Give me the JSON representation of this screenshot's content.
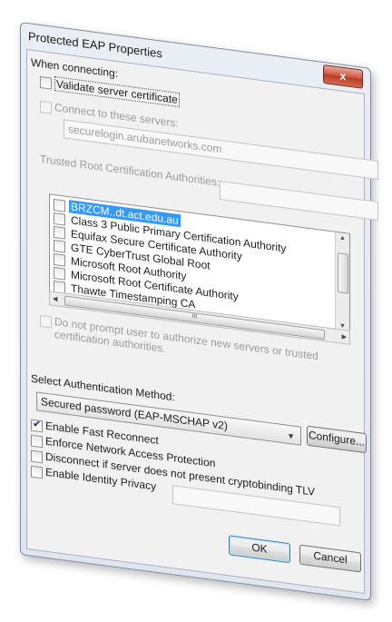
{
  "window": {
    "title": "Protected EAP Properties",
    "close_label": "x"
  },
  "when_connecting_label": "When connecting:",
  "validate_cert": {
    "label": "Validate server certificate",
    "checked": false
  },
  "connect_servers": {
    "label": "Connect to these servers:",
    "checked": false,
    "value": "securelogin.arubanetworks.com"
  },
  "trusted_ca_label": "Trusted Root Certification Authorities:",
  "ca_list": [
    {
      "label": "BRZCM..dt.act.edu.au",
      "selected": true
    },
    {
      "label": "Class 3 Public Primary Certification Authority"
    },
    {
      "label": "Equifax Secure Certificate Authority"
    },
    {
      "label": "GTE CyberTrust Global Root"
    },
    {
      "label": "Microsoft Root Authority"
    },
    {
      "label": "Microsoft Root Certificate Authority"
    },
    {
      "label": "Thawte Timestamping CA"
    }
  ],
  "hscroll_grip": "III",
  "do_not_prompt": {
    "line1": "Do not prompt user to authorize new servers or trusted",
    "line2": "certification authorities."
  },
  "auth_method": {
    "label": "Select Authentication Method:",
    "value": "Secured password (EAP-MSCHAP v2)",
    "configure_label": "Configure..."
  },
  "options": [
    {
      "label": "Enable Fast Reconnect",
      "checked": true
    },
    {
      "label": "Enforce Network Access Protection",
      "checked": false
    },
    {
      "label": "Disconnect if server does not present cryptobinding TLV",
      "checked": false
    },
    {
      "label": "Enable Identity Privacy",
      "checked": false
    }
  ],
  "buttons": {
    "ok": "OK",
    "cancel": "Cancel"
  }
}
